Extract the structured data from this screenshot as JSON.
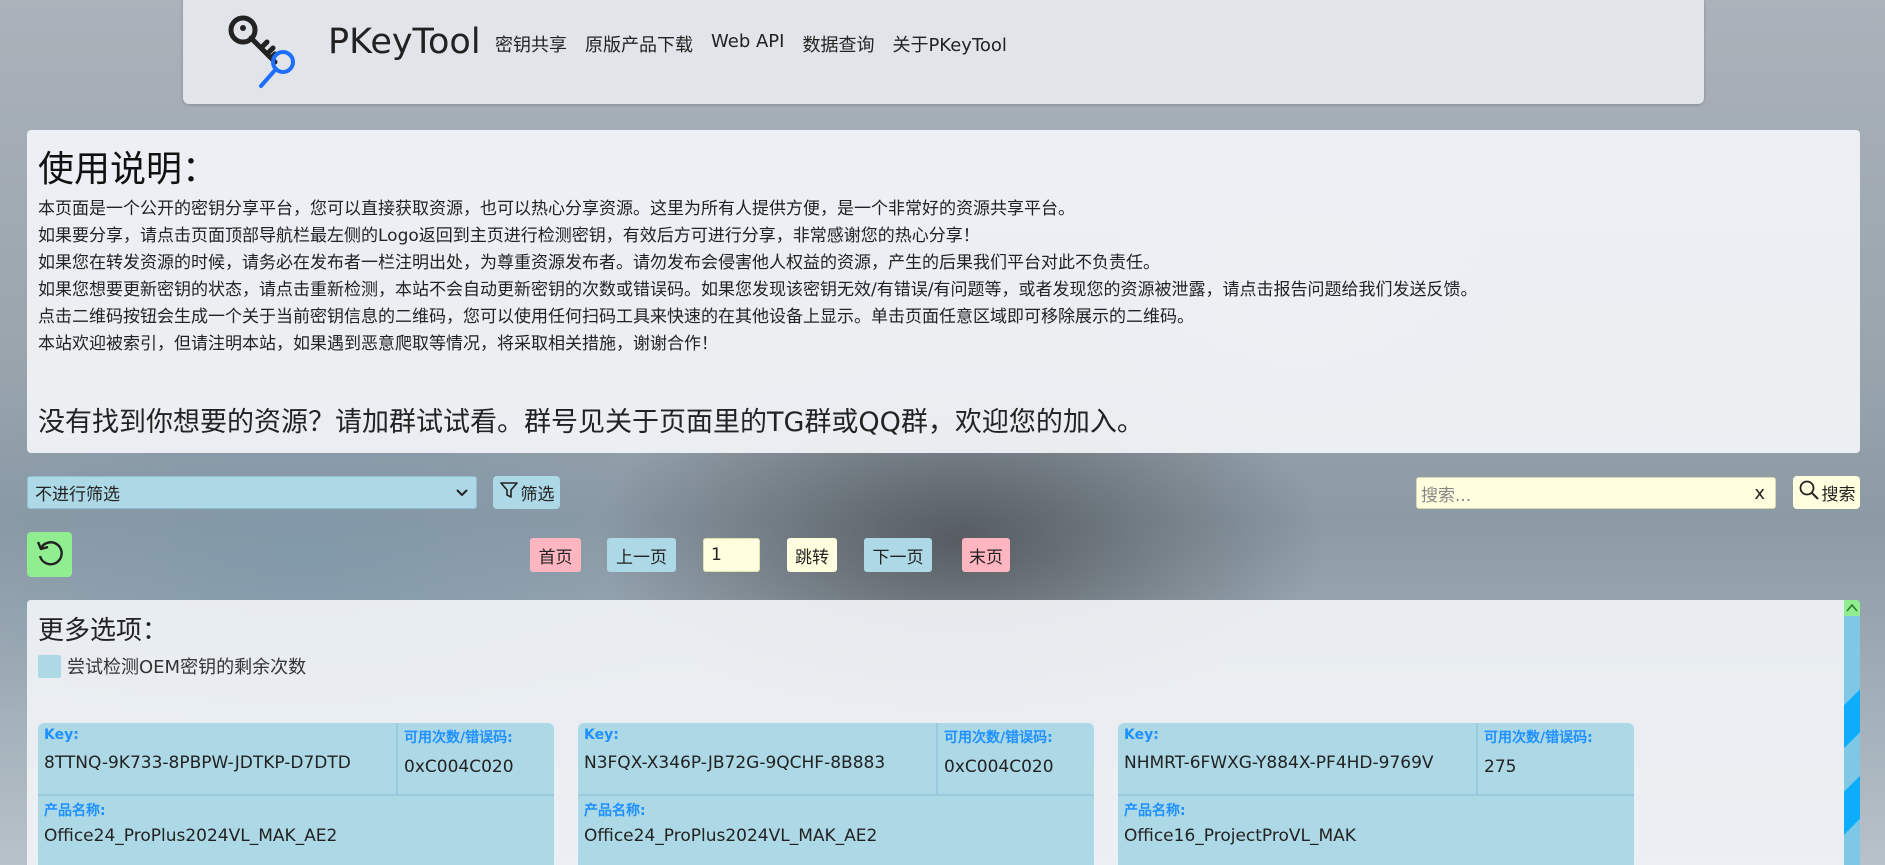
{
  "brand": "PKeyTool",
  "nav": [
    "密钥共享",
    "原版产品下载",
    "Web API",
    "数据查询",
    "关于PKeyTool"
  ],
  "intro": {
    "title": "使用说明：",
    "lines": [
      "本页面是一个公开的密钥分享平台，您可以直接获取资源，也可以热心分享资源。这里为所有人提供方便，是一个非常好的资源共享平台。",
      "如果要分享，请点击页面顶部导航栏最左侧的Logo返回到主页进行检测密钥，有效后方可进行分享，非常感谢您的热心分享！",
      "如果您在转发资源的时候，请务必在发布者一栏注明出处，为尊重资源发布者。请勿发布会侵害他人权益的资源，产生的后果我们平台对此不负责任。",
      "如果您想要更新密钥的状态，请点击重新检测，本站不会自动更新密钥的次数或错误码。如果您发现该密钥无效/有错误/有问题等，或者发现您的资源被泄露，请点击报告问题给我们发送反馈。",
      "点击二维码按钮会生成一个关于当前密钥信息的二维码，您可以使用任何扫码工具来快速的在其他设备上显示。单击页面任意区域即可移除展示的二维码。",
      "本站欢迎被索引，但请注明本站，如果遇到恶意爬取等情况，将采取相关措施，谢谢合作！"
    ],
    "notice": "没有找到你想要的资源？请加群试试看。群号见关于页面里的TG群或QQ群，欢迎您的加入。"
  },
  "filter": {
    "selected": "不进行筛选",
    "button": "筛选"
  },
  "search": {
    "placeholder": "搜索...",
    "clear": "x",
    "button": "搜索"
  },
  "pager": {
    "first": "首页",
    "prev": "上一页",
    "page": "1",
    "jump": "跳转",
    "next": "下一页",
    "last": "末页"
  },
  "more": {
    "title": "更多选项：",
    "oem_label": "尝试检测OEM密钥的剩余次数"
  },
  "card_labels": {
    "key": "Key:",
    "count": "可用次数/错误码:",
    "product": "产品名称:"
  },
  "cards": [
    {
      "key": "8TTNQ-9K733-8PBPW-JDTKP-D7DTD",
      "count": "0xC004C020",
      "product": "Office24_ProPlus2024VL_MAK_AE2"
    },
    {
      "key": "N3FQX-X346P-JB72G-9QCHF-8B883",
      "count": "0xC004C020",
      "product": "Office24_ProPlus2024VL_MAK_AE2"
    },
    {
      "key": "NHMRT-6FWXG-Y884X-PF4HD-9769V",
      "count": "275",
      "product": "Office16_ProjectProVL_MAK"
    }
  ],
  "colors": {
    "accent_blue": "#add8e6",
    "label_blue": "#1e90ff",
    "pink": "#ffb6c1",
    "yellow": "#ffffe0",
    "green": "#90ee90"
  }
}
